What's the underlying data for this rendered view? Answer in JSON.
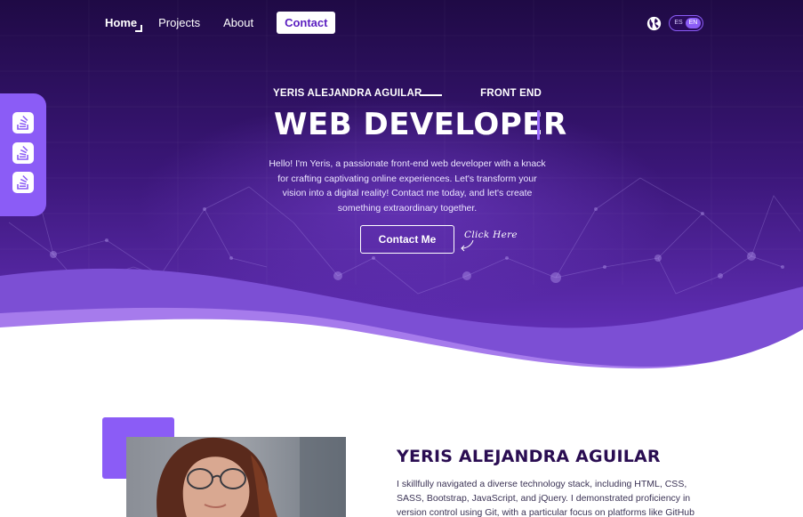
{
  "nav": {
    "home": "Home",
    "projects": "Projects",
    "about": "About",
    "contact": "Contact"
  },
  "language": {
    "icon": "globe-icon",
    "es": "ES",
    "en": "EN",
    "active": "EN"
  },
  "social": [
    {
      "icon": "stack-overflow-icon"
    },
    {
      "icon": "stack-overflow-icon"
    },
    {
      "icon": "stack-overflow-icon"
    }
  ],
  "hero": {
    "name": "YERIS ALEJANDRA AGUILAR",
    "role": "FRONT END",
    "title": "WEB DEVELOPER",
    "description": "Hello! I'm Yeris, a passionate front-end web developer with a knack for crafting captivating online experiences. Let's transform your vision into a digital reality! Contact me today, and let's create something extraordinary together.",
    "cta": "Contact Me",
    "hint": "Click Here"
  },
  "about": {
    "name": "YERIS ALEJANDRA AGUILAR",
    "text": "I skillfully navigated a diverse technology stack, including HTML, CSS, SASS, Bootstrap, JavaScript, and jQuery. I demonstrated proficiency in version control using Git, with a particular focus on platforms like GitHub"
  },
  "colors": {
    "hero_top": "#1f0a45",
    "hero_bottom": "#6a34c4",
    "accent": "#8b5cf6",
    "heading_dark": "#2a0d52"
  }
}
